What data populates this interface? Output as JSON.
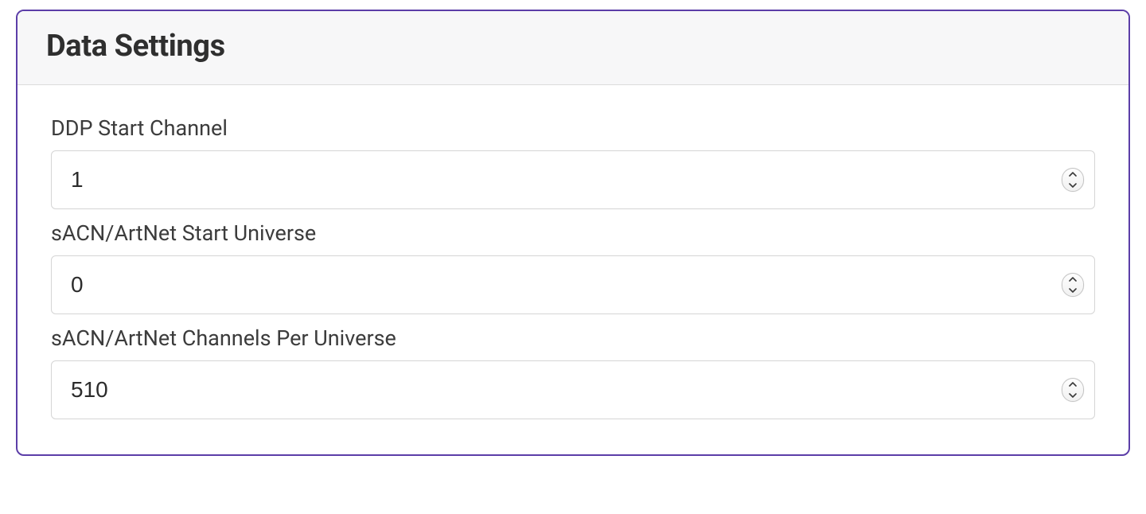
{
  "panel": {
    "title": "Data Settings",
    "fields": {
      "ddp_start_channel": {
        "label": "DDP Start Channel",
        "value": "1"
      },
      "sacn_artnet_start_universe": {
        "label": "sACN/ArtNet Start Universe",
        "value": "0"
      },
      "sacn_artnet_channels_per_universe": {
        "label": "sACN/ArtNet Channels Per Universe",
        "value": "510"
      }
    }
  }
}
